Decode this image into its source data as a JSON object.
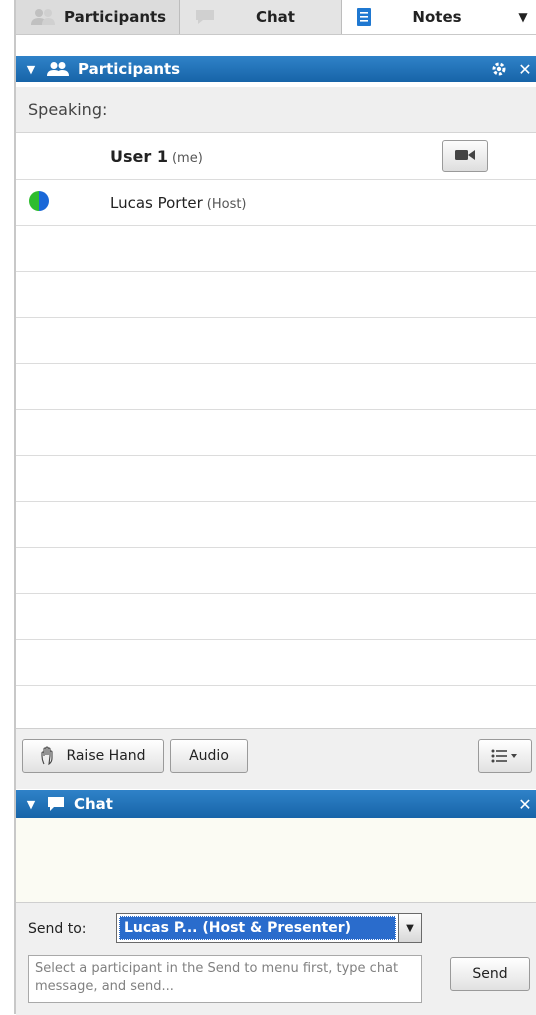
{
  "tabs": [
    {
      "label": "Participants",
      "icon": "participants-icon",
      "active": true
    },
    {
      "label": "Chat",
      "icon": "chat-bubble-icon",
      "active": false
    },
    {
      "label": "Notes",
      "icon": "notes-icon",
      "active": false
    }
  ],
  "participants_panel": {
    "title": "Participants",
    "speaking_label": "Speaking:",
    "participants": [
      {
        "name": "User 1",
        "role": "(me)",
        "bold": true,
        "has_camera_button": true,
        "status_icon": null
      },
      {
        "name": "Lucas Porter",
        "role": "(Host)",
        "bold": false,
        "has_camera_button": false,
        "status_icon": "green-blue-status-orb-icon"
      }
    ],
    "buttons": {
      "raise_hand": "Raise Hand",
      "audio": "Audio"
    }
  },
  "chat_panel": {
    "title": "Chat",
    "send_to_label": "Send to:",
    "send_to_value": "Lucas P...  (Host & Presenter)",
    "input_placeholder": "Select a participant in the Send to menu first, type chat message, and send...",
    "send_button": "Send"
  },
  "colors": {
    "header_blue": "#1d6fb8",
    "selection_blue": "#2a6ccc"
  }
}
